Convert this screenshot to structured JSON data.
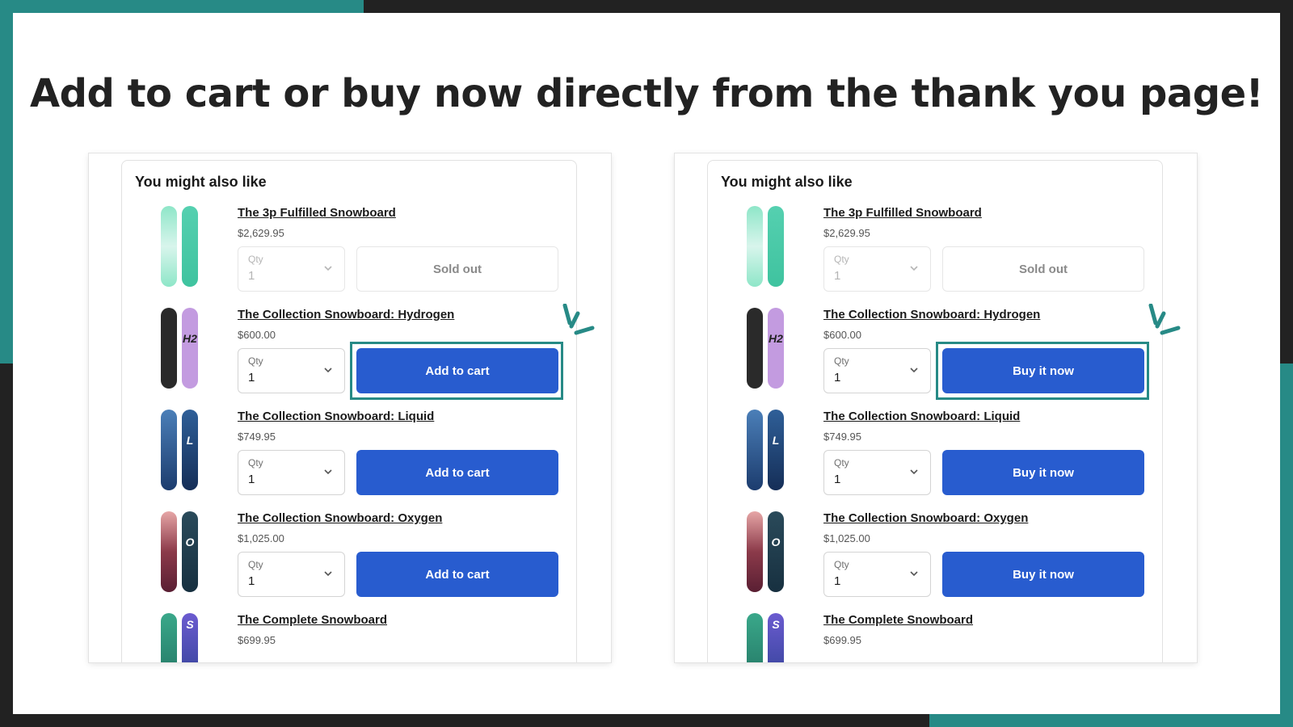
{
  "headline": "Add to cart or buy now directly from the thank you page!",
  "colors": {
    "teal": "#278a86",
    "dark": "#222222",
    "button_blue": "#285ccf"
  },
  "panels": [
    {
      "title": "You might also like",
      "products": [
        {
          "name": "The 3p Fulfilled Snowboard",
          "price": "$2,629.95",
          "qty_label": "Qty",
          "qty_value": "1",
          "action": "Sold out"
        },
        {
          "name": "The Collection Snowboard: Hydrogen",
          "price": "$600.00",
          "qty_label": "Qty",
          "qty_value": "1",
          "action": "Add to cart"
        },
        {
          "name": "The Collection Snowboard: Liquid",
          "price": "$749.95",
          "qty_label": "Qty",
          "qty_value": "1",
          "action": "Add to cart"
        },
        {
          "name": "The Collection Snowboard: Oxygen",
          "price": "$1,025.00",
          "qty_label": "Qty",
          "qty_value": "1",
          "action": "Add to cart"
        },
        {
          "name": "The Complete Snowboard",
          "price": "$699.95"
        }
      ]
    },
    {
      "title": "You might also like",
      "products": [
        {
          "name": "The 3p Fulfilled Snowboard",
          "price": "$2,629.95",
          "qty_label": "Qty",
          "qty_value": "1",
          "action": "Sold out"
        },
        {
          "name": "The Collection Snowboard: Hydrogen",
          "price": "$600.00",
          "qty_label": "Qty",
          "qty_value": "1",
          "action": "Buy it now"
        },
        {
          "name": "The Collection Snowboard: Liquid",
          "price": "$749.95",
          "qty_label": "Qty",
          "qty_value": "1",
          "action": "Buy it now"
        },
        {
          "name": "The Collection Snowboard: Oxygen",
          "price": "$1,025.00",
          "qty_label": "Qty",
          "qty_value": "1",
          "action": "Buy it now"
        },
        {
          "name": "The Complete Snowboard",
          "price": "$699.95"
        }
      ]
    }
  ]
}
